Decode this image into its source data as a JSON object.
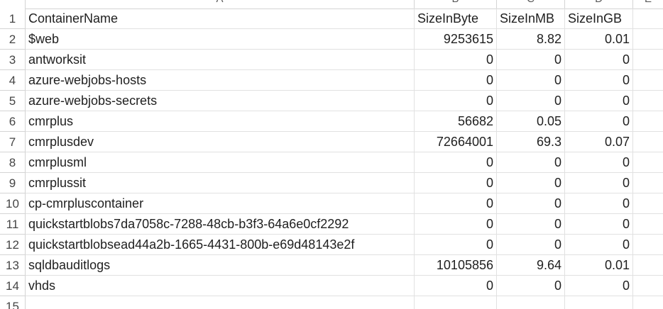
{
  "column_headers": [
    "A",
    "B",
    "C",
    "D",
    "E"
  ],
  "header_row": {
    "row": "1",
    "cells": [
      "ContainerName",
      "SizeInByte",
      "SizeInMB",
      "SizeInGB",
      ""
    ]
  },
  "rows": [
    {
      "row": "2",
      "cells": [
        "$web",
        "9253615",
        "8.82",
        "0.01",
        ""
      ]
    },
    {
      "row": "3",
      "cells": [
        "antworksit",
        "0",
        "0",
        "0",
        ""
      ]
    },
    {
      "row": "4",
      "cells": [
        "azure-webjobs-hosts",
        "0",
        "0",
        "0",
        ""
      ]
    },
    {
      "row": "5",
      "cells": [
        "azure-webjobs-secrets",
        "0",
        "0",
        "0",
        ""
      ]
    },
    {
      "row": "6",
      "cells": [
        "cmrplus",
        "56682",
        "0.05",
        "0",
        ""
      ]
    },
    {
      "row": "7",
      "cells": [
        "cmrplusdev",
        "72664001",
        "69.3",
        "0.07",
        ""
      ]
    },
    {
      "row": "8",
      "cells": [
        "cmrplusml",
        "0",
        "0",
        "0",
        ""
      ]
    },
    {
      "row": "9",
      "cells": [
        "cmrplussit",
        "0",
        "0",
        "0",
        ""
      ]
    },
    {
      "row": "10",
      "cells": [
        "cp-cmrpluscontainer",
        "0",
        "0",
        "0",
        ""
      ]
    },
    {
      "row": "11",
      "cells": [
        "quickstartblobs7da7058c-7288-48cb-b3f3-64a6e0cf2292",
        "0",
        "0",
        "0",
        ""
      ]
    },
    {
      "row": "12",
      "cells": [
        "quickstartblobsead44a2b-1665-4431-800b-e69d48143e2f",
        "0",
        "0",
        "0",
        ""
      ]
    },
    {
      "row": "13",
      "cells": [
        "sqldbauditlogs",
        "10105856",
        "9.64",
        "0.01",
        ""
      ]
    },
    {
      "row": "14",
      "cells": [
        "vhds",
        "0",
        "0",
        "0",
        ""
      ]
    },
    {
      "row": "15",
      "cells": [
        "",
        "",
        "",
        "",
        ""
      ]
    }
  ]
}
